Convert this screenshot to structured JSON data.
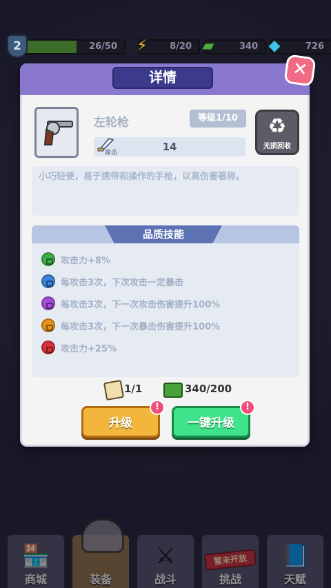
{
  "status_bar": {
    "level": "2",
    "xp": "26/50",
    "xp_fraction": 0.52,
    "energy": "8/20",
    "cash": "340",
    "gems": "726"
  },
  "modal": {
    "title": "详情",
    "item": {
      "name": "左轮枪",
      "level_label": "等级1/10",
      "stat_label": "攻击",
      "stat_value": "14",
      "recycle_label": "无损回收",
      "description": "小巧轻便，易于携带和操作的手枪，以高伤害著称。"
    },
    "skills": {
      "title": "品质技能",
      "items": [
        {
          "text": "攻击力+8%",
          "color": "#3fae4a"
        },
        {
          "text": "每攻击3次，下次攻击一定暴击",
          "color": "#3b84d8"
        },
        {
          "text": "每攻击3次，下一次攻击伤害提升100%",
          "color": "#a44ed8"
        },
        {
          "text": "每攻击3次，下一次暴击伤害提升100%",
          "color": "#e8921e"
        },
        {
          "text": "攻击力+25%",
          "color": "#d8323a"
        }
      ]
    },
    "cost": {
      "scroll": "1/1",
      "cash": "340/200"
    },
    "buttons": {
      "upgrade": "升级",
      "upgrade_all": "一键升级",
      "badge": "!"
    }
  },
  "bottom_nav": [
    {
      "label": "商城",
      "icon": "shop-icon"
    },
    {
      "label": "装备",
      "icon": "armor-icon"
    },
    {
      "label": "战斗",
      "icon": "battle-icon"
    },
    {
      "label": "挑战",
      "icon": "challenge-icon",
      "locked_label": "暂未开放"
    },
    {
      "label": "天赋",
      "icon": "talent-book-icon"
    }
  ]
}
